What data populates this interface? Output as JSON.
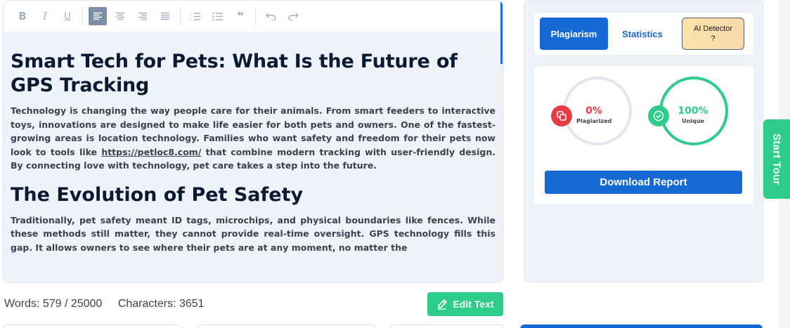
{
  "toolbar": {
    "buttons": [
      {
        "name": "bold",
        "glyph": "B"
      },
      {
        "name": "italic",
        "glyph": "I"
      },
      {
        "name": "underline",
        "glyph": "U"
      },
      {
        "name": "align-left",
        "active": true
      },
      {
        "name": "align-center"
      },
      {
        "name": "align-right"
      },
      {
        "name": "align-justify"
      },
      {
        "name": "ordered-list"
      },
      {
        "name": "bullet-list"
      },
      {
        "name": "blockquote",
        "glyph": "❝"
      },
      {
        "name": "undo"
      },
      {
        "name": "redo"
      }
    ]
  },
  "article": {
    "title": "Smart Tech for Pets: What Is the Future of GPS Tracking",
    "para1_before": "Technology is changing the way people care for their animals. From smart feeders to interactive toys, innovations are designed to make life easier for both pets and owners. One of the fastest-growing areas is location technology. Families who want safety and freedom for their pets now look to tools like ",
    "para1_link": "https://petloc8.com/",
    "para1_after": " that combine modern tracking with user-friendly design. By connecting love with technology, pet care takes a step into the future.",
    "heading2": "The Evolution of Pet Safety",
    "para2": "Traditionally, pet safety meant ID tags, microchips, and physical boundaries like fences. While these methods still matter, they cannot provide real-time oversight. GPS technology fills this gap. It allows owners to see where their pets are at any moment, no matter the"
  },
  "status": {
    "words": "Words: 579 / 25000",
    "characters": "Characters: 3651"
  },
  "edit_button": "Edit Text",
  "side": {
    "tabs": {
      "plagiarism": "Plagiarism",
      "statistics": "Statistics",
      "ai_detector": "AI Detector",
      "ai_detector_help": "?"
    },
    "results": {
      "plagiarized_value": "0%",
      "plagiarized_label": "Plagiarized",
      "plagiarized_fraction": 0.0,
      "unique_value": "100%",
      "unique_label": "Unique",
      "unique_fraction": 1.0
    },
    "download_button": "Download Report"
  },
  "start_tour": "Start Tour",
  "colors": {
    "primary_blue": "#1769d6",
    "green": "#2ecc8a",
    "red": "#e53b44"
  }
}
